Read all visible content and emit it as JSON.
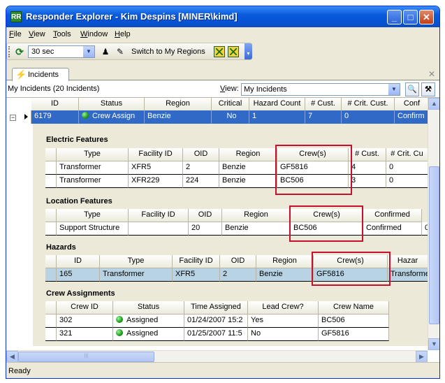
{
  "window": {
    "title": "Responder Explorer - Kim Despins [MINER\\kimd]",
    "icon_text": "RR",
    "min_label": "_",
    "max_label": "□",
    "close_label": "✕"
  },
  "menu": [
    "File",
    "View",
    "Tools",
    "Window",
    "Help"
  ],
  "toolbar": {
    "interval": "30 sec",
    "switch_label": "Switch to My Regions"
  },
  "tab": {
    "label": "Incidents"
  },
  "viewbar": {
    "count_text": "My Incidents (20 Incidents)",
    "view_label": "View:",
    "view_value": "My Incidents"
  },
  "incidents": {
    "headers": [
      "ID",
      "Status",
      "Region",
      "Critical",
      "Hazard Count",
      "# Cust.",
      "# Crit. Cust.",
      "Conf"
    ],
    "row": {
      "id": "6179",
      "status": "Crew Assign",
      "region": "Benzie",
      "critical": "No",
      "hazard_count": "1",
      "cust": "7",
      "crit_cust": "0",
      "conf": "Confirm"
    }
  },
  "electric": {
    "title": "Electric Features",
    "headers": [
      "Type",
      "Facility ID",
      "OID",
      "Region",
      "Crew(s)",
      "# Cust.",
      "# Crit. Cu"
    ],
    "rows": [
      [
        "Transformer",
        "XFR5",
        "2",
        "Benzie",
        "GF5816",
        "4",
        "0"
      ],
      [
        "Transformer",
        "XFR229",
        "224",
        "Benzie",
        "BC506",
        "3",
        "0"
      ]
    ]
  },
  "location": {
    "title": "Location Features",
    "headers": [
      "Type",
      "Facility ID",
      "OID",
      "Region",
      "Crew(s)",
      "Confirmed"
    ],
    "rows": [
      [
        "Support Structure",
        "",
        "20",
        "Benzie",
        "BC506",
        "Confirmed",
        "0"
      ]
    ]
  },
  "hazards": {
    "title": "Hazards",
    "headers": [
      "ID",
      "Type",
      "Facility ID",
      "OID",
      "Region",
      "Crew(s)",
      "Hazar"
    ],
    "rows": [
      [
        "165",
        "Transformer",
        "XFR5",
        "2",
        "Benzie",
        "GF5816",
        "Transforme"
      ]
    ]
  },
  "crews": {
    "title": "Crew Assignments",
    "headers": [
      "Crew ID",
      "Status",
      "Time Assigned",
      "Lead Crew?",
      "Crew Name"
    ],
    "rows": [
      [
        "302",
        "Assigned",
        "01/24/2007 15:2",
        "Yes",
        "BC506"
      ],
      [
        "321",
        "Assigned",
        "01/25/2007 11:5",
        "No",
        "GF5816"
      ]
    ]
  },
  "status": {
    "text": "Ready"
  },
  "colors": {
    "title_blue": "#0654d6",
    "selected_row": "#3169c6",
    "highlight_row": "#b7d3e4",
    "annotation_red": "#c8102e",
    "assigned_green": "#1b9b1b"
  }
}
